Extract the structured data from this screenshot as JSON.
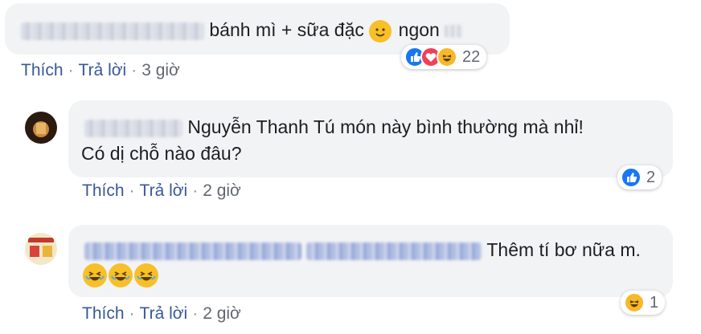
{
  "comment1": {
    "text": "bánh mì + sữa đặc",
    "text_after": "ngon",
    "actions": {
      "like": "Thích",
      "reply": "Trả lời",
      "time": "3 giờ"
    },
    "reactions": {
      "icons": [
        "like-icon",
        "love-icon",
        "haha-icon"
      ],
      "count": "22"
    }
  },
  "comment2": {
    "mention": "Nguyễn Thanh Tú",
    "text_line1": "món này bình thường mà nhỉ!",
    "text_line2": "Có dị chỗ nào đâu?",
    "actions": {
      "like": "Thích",
      "reply": "Trả lời",
      "time": "2 giờ"
    },
    "reactions": {
      "icons": [
        "like-icon"
      ],
      "count": "2"
    }
  },
  "comment3": {
    "text": "Thêm tí bơ nữa m.",
    "emojis": [
      "rofl-emoji",
      "rofl-emoji",
      "rofl-emoji"
    ],
    "actions": {
      "like": "Thích",
      "reply": "Trả lời",
      "time": "2 giờ"
    },
    "reactions": {
      "icons": [
        "haha-icon"
      ],
      "count": "1"
    }
  },
  "colors": {
    "bubble": "#f2f3f5",
    "link": "#385898",
    "like": "#1877f2",
    "love": "#f33e58",
    "haha": "#f7b928"
  }
}
